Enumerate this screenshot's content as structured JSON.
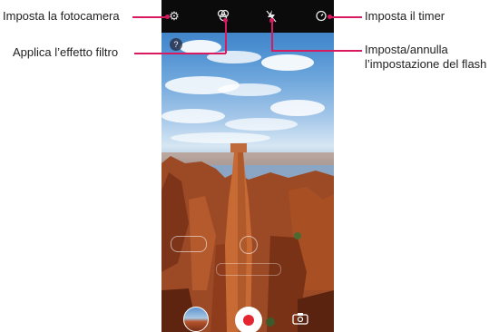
{
  "callouts": {
    "camera_settings": "Imposta la fotocamera",
    "filter_effect": "Applica l’effetto filtro",
    "timer": "Imposta il timer",
    "flash_line1": "Imposta/annulla",
    "flash_line2": "l’impostazione del flash"
  },
  "camera_ui": {
    "top_icons": {
      "settings": "gear-icon",
      "filter": "filter-icon",
      "flash": "flash-off-icon",
      "timer": "timer-icon"
    },
    "help_label": "?",
    "bottom_icons": {
      "gallery": "gallery-thumbnail",
      "record": "record-icon",
      "switch": "switch-camera-icon"
    }
  },
  "colors": {
    "accent": "#d81b60",
    "record": "#e3262f",
    "topbar": "#0b0b0b"
  }
}
